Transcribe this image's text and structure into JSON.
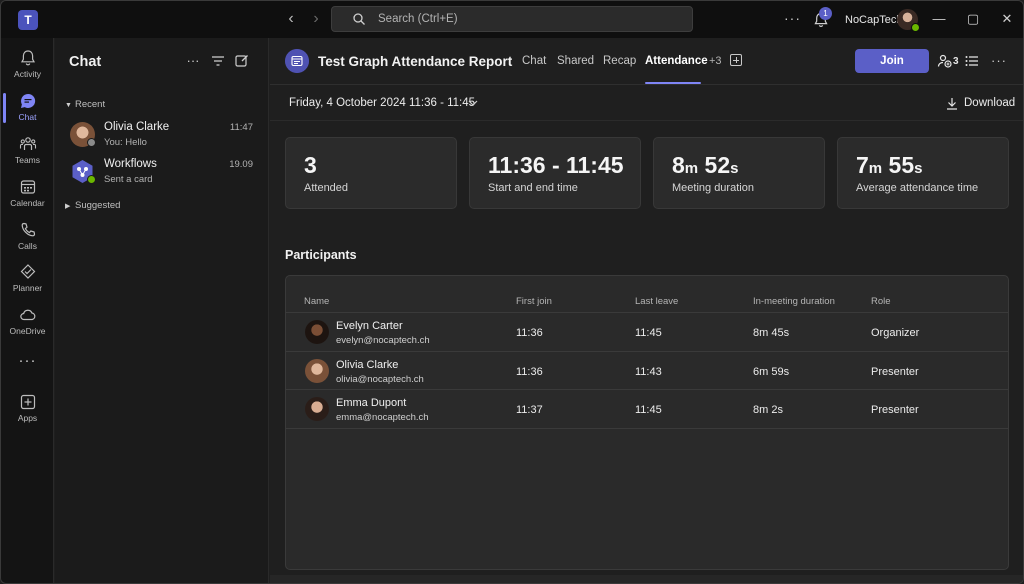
{
  "titlebar": {
    "app_icon": "teams-logo",
    "search_placeholder": "Search (Ctrl+E)",
    "more": "···",
    "notification_count": "1",
    "org_name": "NoCapTech"
  },
  "rail": {
    "items": [
      {
        "label": "Activity",
        "icon": "bell-icon"
      },
      {
        "label": "Chat",
        "icon": "chat-icon",
        "active": true
      },
      {
        "label": "Teams",
        "icon": "teams-icon"
      },
      {
        "label": "Calendar",
        "icon": "calendar-icon"
      },
      {
        "label": "Calls",
        "icon": "phone-icon"
      },
      {
        "label": "Planner",
        "icon": "planner-icon"
      },
      {
        "label": "OneDrive",
        "icon": "cloud-icon"
      },
      {
        "label": "Apps",
        "icon": "apps-icon"
      }
    ],
    "more": "···"
  },
  "chat_pane": {
    "title": "Chat",
    "recent_label": "Recent",
    "suggested_label": "Suggested",
    "chats": [
      {
        "name": "Olivia Clarke",
        "preview": "You: Hello",
        "time": "11:47"
      },
      {
        "name": "Workflows",
        "preview": "Sent a card",
        "time": "19.09"
      }
    ]
  },
  "meeting": {
    "title": "Test Graph Attendance Report",
    "tabs": [
      "Chat",
      "Shared",
      "Recap",
      "Attendance"
    ],
    "active_tab": "Attendance",
    "more_tabs": "+3",
    "join_label": "Join",
    "participant_count": "3"
  },
  "report": {
    "date_range": "Friday, 4 October 2024 11:36 - 11:45",
    "download_label": "Download",
    "stats": [
      {
        "value": "3",
        "caption": "Attended"
      },
      {
        "value": "11:36 - 11:45",
        "caption": "Start and end time"
      },
      {
        "value_min": "8",
        "unit_min": "m",
        "value_sec": "52",
        "unit_sec": "s",
        "caption": "Meeting duration"
      },
      {
        "value_min": "7",
        "unit_min": "m",
        "value_sec": "55",
        "unit_sec": "s",
        "caption": "Average attendance time"
      }
    ],
    "participants_title": "Participants",
    "columns": [
      "Name",
      "First join",
      "Last leave",
      "In-meeting duration",
      "Role"
    ],
    "participants": [
      {
        "name": "Evelyn Carter",
        "email": "evelyn@nocaptech.ch",
        "first_join": "11:36",
        "last_leave": "11:45",
        "duration": "8m 45s",
        "role": "Organizer"
      },
      {
        "name": "Olivia Clarke",
        "email": "olivia@nocaptech.ch",
        "first_join": "11:36",
        "last_leave": "11:43",
        "duration": "6m 59s",
        "role": "Presenter"
      },
      {
        "name": "Emma Dupont",
        "email": "emma@nocaptech.ch",
        "first_join": "11:37",
        "last_leave": "11:45",
        "duration": "8m 2s",
        "role": "Presenter"
      }
    ]
  },
  "colors": {
    "accent": "#5b5fc7",
    "accent_light": "#7f85f5",
    "presence_available": "#6bb700"
  }
}
